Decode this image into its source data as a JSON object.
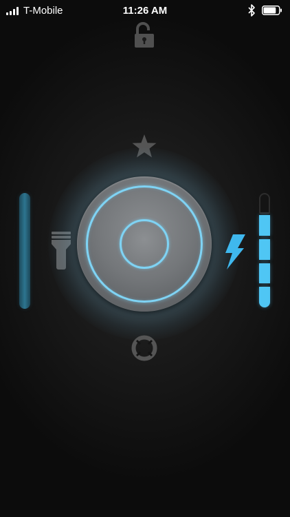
{
  "status_bar": {
    "carrier": "T-Mobile",
    "time": "11:26 AM",
    "signal_bars": 4,
    "battery_level": 0.85
  },
  "icons": {
    "lock": "unlocked-padlock-icon",
    "favorite": "star-icon",
    "flashlight": "flashlight-icon",
    "strobe": "lightning-bolt-icon",
    "help": "lifebuoy-icon",
    "power": "power-button"
  },
  "brightness": {
    "level": 1.0
  },
  "strobe": {
    "active_segments": 4,
    "total_segments": 4
  },
  "colors": {
    "accent": "#4fc6f4",
    "ring": "#7fd3f4",
    "slider": "#2d7590",
    "icon_gray": "#5a5a5a"
  }
}
